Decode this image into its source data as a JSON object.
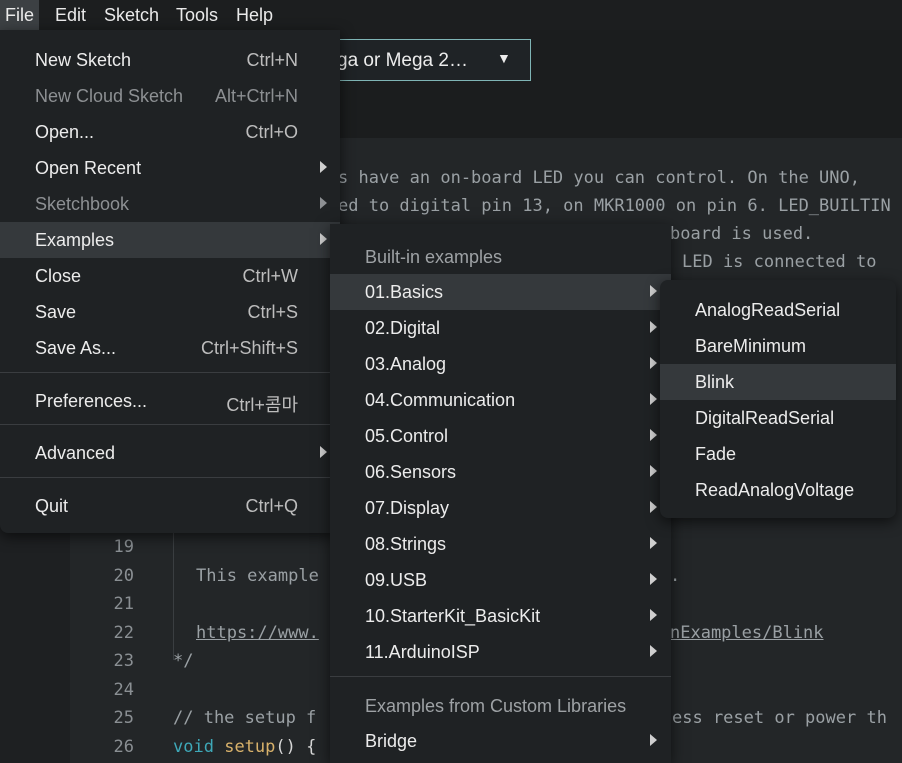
{
  "menubar": {
    "items": [
      "File",
      "Edit",
      "Sketch",
      "Tools",
      "Help"
    ]
  },
  "board_selector": {
    "label": "ga or Mega 2…"
  },
  "editor": {
    "lines": [
      "s have an on-board LED you can control. On the UNO,",
      "ed to digital pin 13, on MKR1000 on pin 6. LED_BUILTIN",
      "board is used.",
      "LED is connected to"
    ],
    "line_numbers": [
      "19",
      "20",
      "21",
      "22",
      "23",
      "24",
      "25",
      "26"
    ],
    "line20": "This example",
    "line20_tail": ".",
    "line22_link": "https://www.",
    "line22_tail": "nExamples/Blink",
    "line23": "*/",
    "line25": "// the setup f",
    "line25_tail": "ess reset or power th",
    "line26_kw": "void",
    "line26_fn": "setup",
    "line26_rest": "() {"
  },
  "file_menu": {
    "items": [
      {
        "label": "New Sketch",
        "shortcut": "Ctrl+N"
      },
      {
        "label": "New Cloud Sketch",
        "shortcut": "Alt+Ctrl+N"
      },
      {
        "label": "Open...",
        "shortcut": "Ctrl+O"
      },
      {
        "label": "Open Recent",
        "shortcut": ""
      },
      {
        "label": "Sketchbook",
        "shortcut": ""
      },
      {
        "label": "Examples",
        "shortcut": ""
      },
      {
        "label": "Close",
        "shortcut": "Ctrl+W"
      },
      {
        "label": "Save",
        "shortcut": "Ctrl+S"
      },
      {
        "label": "Save As...",
        "shortcut": "Ctrl+Shift+S"
      },
      {
        "label": "Preferences...",
        "shortcut": "Ctrl+콤마"
      },
      {
        "label": "Advanced",
        "shortcut": ""
      },
      {
        "label": "Quit",
        "shortcut": "Ctrl+Q"
      }
    ]
  },
  "examples_menu": {
    "header_builtin": "Built-in examples",
    "items": [
      "01.Basics",
      "02.Digital",
      "03.Analog",
      "04.Communication",
      "05.Control",
      "06.Sensors",
      "07.Display",
      "08.Strings",
      "09.USB",
      "10.StarterKit_BasicKit",
      "11.ArduinoISP"
    ],
    "header_custom": "Examples from Custom Libraries",
    "custom_items": [
      "Bridge"
    ]
  },
  "basics_menu": {
    "items": [
      "AnalogReadSerial",
      "BareMinimum",
      "Blink",
      "DigitalReadSerial",
      "Fade",
      "ReadAnalogVoltage"
    ]
  },
  "colors": {
    "accent_teal": "#3ea8b8",
    "highlight": "#35393c",
    "board_border": "#7fb5b5"
  }
}
